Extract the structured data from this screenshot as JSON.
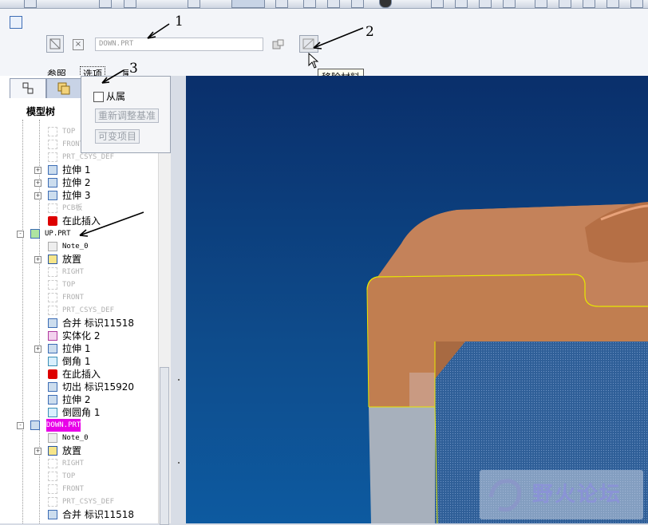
{
  "dashboard": {
    "name_field_value": "DOWN.PRT",
    "tabs": [
      "参照",
      "选项",
      "属性"
    ],
    "tooltip": "移除材料"
  },
  "options_panel": {
    "checkbox_label": "从属",
    "button1": "重新调整基准",
    "button2": "可变项目"
  },
  "tree": {
    "title": "模型树",
    "rows": [
      {
        "label": "TOP",
        "dim": true
      },
      {
        "label": "FRONT",
        "dim": true
      },
      {
        "label": "PRT_CSYS_DEF",
        "dim": true
      },
      {
        "label": "拉伸 1"
      },
      {
        "label": "拉伸 2"
      },
      {
        "label": "拉伸 3"
      },
      {
        "label": "PCB板",
        "dim": true
      },
      {
        "label": "在此插入"
      },
      {
        "label": "UP.PRT"
      },
      {
        "label": "Note_0"
      },
      {
        "label": "放置"
      },
      {
        "label": "RIGHT",
        "dim": true
      },
      {
        "label": "TOP",
        "dim": true
      },
      {
        "label": "FRONT",
        "dim": true
      },
      {
        "label": "PRT_CSYS_DEF",
        "dim": true
      },
      {
        "label": "合并 标识11518"
      },
      {
        "label": "实体化 2"
      },
      {
        "label": "拉伸 1"
      },
      {
        "label": "倒角 1"
      },
      {
        "label": "在此插入"
      },
      {
        "label": "切出 标识15920"
      },
      {
        "label": "拉伸 2"
      },
      {
        "label": "倒圆角 1"
      },
      {
        "label": "DOWN.PRT"
      },
      {
        "label": "Note_0"
      },
      {
        "label": "放置"
      },
      {
        "label": "RIGHT",
        "dim": true
      },
      {
        "label": "TOP",
        "dim": true
      },
      {
        "label": "FRONT",
        "dim": true
      },
      {
        "label": "PRT_CSYS_DEF",
        "dim": true
      },
      {
        "label": "合并 标识11518"
      }
    ]
  },
  "annotations": [
    "1",
    "2",
    "3"
  ],
  "watermark": "野火论坛"
}
